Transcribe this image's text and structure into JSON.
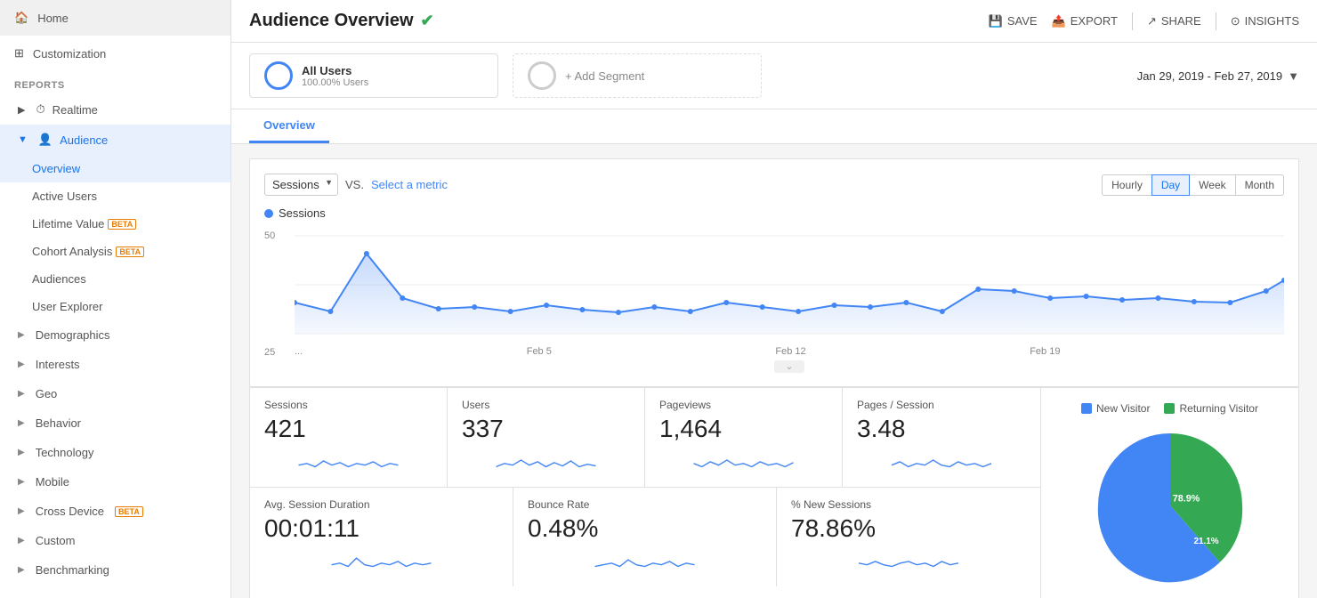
{
  "sidebar": {
    "home_label": "Home",
    "customization_label": "Customization",
    "reports_label": "REPORTS",
    "realtime_label": "Realtime",
    "audience_label": "Audience",
    "overview_label": "Overview",
    "active_users_label": "Active Users",
    "lifetime_value_label": "Lifetime Value",
    "lifetime_value_beta": "BETA",
    "cohort_analysis_label": "Cohort Analysis",
    "cohort_beta": "BETA",
    "audiences_label": "Audiences",
    "user_explorer_label": "User Explorer",
    "demographics_label": "Demographics",
    "interests_label": "Interests",
    "geo_label": "Geo",
    "behavior_label": "Behavior",
    "technology_label": "Technology",
    "mobile_label": "Mobile",
    "cross_device_label": "Cross Device",
    "cross_device_beta": "BETA",
    "custom_label": "Custom",
    "benchmarking_label": "Benchmarking"
  },
  "topbar": {
    "title": "Audience Overview",
    "save_label": "SAVE",
    "export_label": "EXPORT",
    "share_label": "SHARE",
    "insights_label": "INSIGHTS"
  },
  "segment": {
    "all_users_label": "All Users",
    "all_users_pct": "100.00% Users",
    "add_segment_label": "+ Add Segment"
  },
  "date_range": {
    "label": "Jan 29, 2019 - Feb 27, 2019"
  },
  "tabs": {
    "overview_label": "Overview"
  },
  "chart": {
    "metric_default": "Sessions",
    "vs_label": "VS.",
    "select_metric_label": "Select a metric",
    "sessions_legend": "Sessions",
    "y_label_50": "50",
    "y_label_25": "25",
    "time_buttons": [
      "Hourly",
      "Day",
      "Week",
      "Month"
    ],
    "active_time": "Day",
    "x_labels": [
      "...",
      "Feb 5",
      "Feb 12",
      "Feb 19",
      ""
    ]
  },
  "metrics": {
    "row1": [
      {
        "title": "Sessions",
        "value": "421"
      },
      {
        "title": "Users",
        "value": "337"
      },
      {
        "title": "Pageviews",
        "value": "1,464"
      },
      {
        "title": "Pages / Session",
        "value": "3.48"
      }
    ],
    "row2": [
      {
        "title": "Avg. Session Duration",
        "value": "00:01:11"
      },
      {
        "title": "Bounce Rate",
        "value": "0.48%"
      },
      {
        "title": "% New Sessions",
        "value": "78.86%"
      }
    ]
  },
  "pie": {
    "new_visitor_label": "New Visitor",
    "returning_visitor_label": "Returning Visitor",
    "new_pct": "78.9%",
    "returning_pct": "21.1%",
    "new_color": "#4285f4",
    "returning_color": "#34a853"
  }
}
